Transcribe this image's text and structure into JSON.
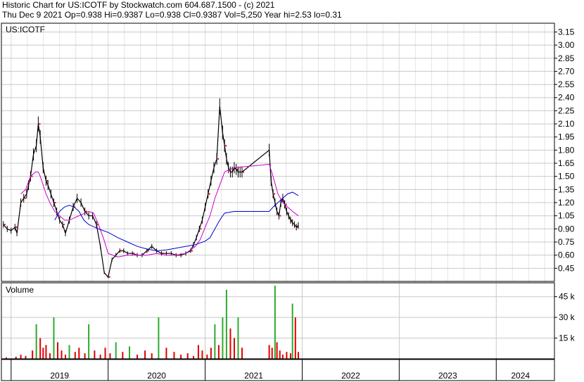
{
  "header": {
    "line1": "Historic Chart for US:ICOTF by Stockwatch.com 604.687.1500 - (c) 2021",
    "line2": "Thu Dec  9 2021   Op=0.938   Hi=0.9387   Lo=0.938   Cl=0.9387   Vol=5,250   Year hi=2.53   lo=0.31"
  },
  "colors": {
    "up": "#2eaa2e",
    "down": "#e00000",
    "price": "#000000",
    "ma_short": "#cc00cc",
    "ma_long": "#0000cc",
    "grid": "#c8c8c8",
    "dot": "#e00000"
  },
  "chart_data": [
    {
      "type": "line",
      "panel": "price",
      "title": "US:ICOTF",
      "xlabel": "",
      "ylabel": "",
      "ylim": [
        0.3,
        3.25
      ],
      "yticks": [
        0.45,
        0.6,
        0.75,
        0.9,
        1.05,
        1.2,
        1.35,
        1.5,
        1.65,
        1.8,
        1.95,
        2.1,
        2.25,
        2.4,
        2.55,
        2.7,
        2.85,
        3.0,
        3.15
      ],
      "ytick_labels": [
        "0.45",
        "0.60",
        "0.75",
        "0.90",
        "1.05",
        "1.20",
        "1.35",
        "1.50",
        "1.65",
        "1.80",
        "1.95",
        "2.10",
        "2.25",
        "2.40",
        "2.55",
        "2.70",
        "2.85",
        "3.00",
        "3.15"
      ],
      "xlim": [
        2018.9,
        2024.6
      ],
      "xtick_labels": [
        "2019",
        "2020",
        "2021",
        "2022",
        "2023",
        "2024"
      ],
      "xtick_positions": [
        2019.5,
        2020.5,
        2021.5,
        2022.5,
        2023.5,
        2024.25
      ],
      "year_boundaries": [
        2019,
        2020,
        2021,
        2022,
        2023,
        2024
      ],
      "grid": true,
      "series": [
        {
          "role": "price",
          "x": [
            2018.92,
            2018.96,
            2019.0,
            2019.04,
            2019.06,
            2019.1,
            2019.13,
            2019.16,
            2019.18,
            2019.2,
            2019.23,
            2019.26,
            2019.28,
            2019.3,
            2019.33,
            2019.36,
            2019.38,
            2019.41,
            2019.44,
            2019.47,
            2019.5,
            2019.53,
            2019.56,
            2019.6,
            2019.64,
            2019.68,
            2019.72,
            2019.76,
            2019.8,
            2019.84,
            2019.88,
            2019.92,
            2019.96,
            2020.0,
            2020.04,
            2020.08,
            2020.12,
            2020.16,
            2020.2,
            2020.25,
            2020.3,
            2020.35,
            2020.4,
            2020.45,
            2020.5,
            2020.55,
            2020.6,
            2020.65,
            2020.7,
            2020.75,
            2020.8,
            2020.85,
            2020.88,
            2020.91,
            2020.94,
            2020.97,
            2021.0,
            2021.03,
            2021.06,
            2021.09,
            2021.12,
            2021.15,
            2021.18,
            2021.2,
            2021.22,
            2021.24,
            2021.26,
            2021.28,
            2021.3,
            2021.32,
            2021.34,
            2021.36,
            2021.38,
            2021.66,
            2021.68,
            2021.7,
            2021.72,
            2021.74,
            2021.76,
            2021.78,
            2021.8,
            2021.82,
            2021.84,
            2021.86,
            2021.88,
            2021.9,
            2021.92,
            2021.94,
            2021.96
          ],
          "y": [
            0.95,
            0.9,
            0.88,
            0.92,
            0.85,
            1.2,
            1.25,
            1.3,
            1.4,
            1.5,
            1.75,
            1.85,
            2.1,
            1.95,
            1.6,
            1.45,
            1.4,
            1.3,
            1.2,
            1.1,
            1.0,
            0.95,
            0.85,
            1.0,
            1.15,
            1.25,
            1.2,
            1.1,
            1.05,
            1.05,
            0.95,
            0.7,
            0.4,
            0.35,
            0.55,
            0.6,
            0.65,
            0.65,
            0.62,
            0.62,
            0.6,
            0.6,
            0.65,
            0.7,
            0.65,
            0.62,
            0.62,
            0.62,
            0.6,
            0.6,
            0.62,
            0.65,
            0.72,
            0.8,
            0.9,
            1.0,
            1.15,
            1.3,
            1.45,
            1.6,
            1.7,
            2.3,
            2.0,
            1.85,
            1.7,
            1.6,
            1.55,
            1.55,
            1.6,
            1.58,
            1.55,
            1.55,
            1.55,
            1.8,
            1.45,
            1.3,
            1.2,
            1.1,
            1.05,
            1.2,
            1.25,
            1.18,
            1.1,
            1.05,
            1.0,
            0.97,
            0.95,
            0.92,
            0.94
          ]
        },
        {
          "role": "moving_average_short",
          "x": [
            2019.1,
            2019.15,
            2019.2,
            2019.25,
            2019.28,
            2019.3,
            2019.33,
            2019.36,
            2019.4,
            2019.45,
            2019.5,
            2019.55,
            2019.6,
            2019.7,
            2019.8,
            2019.85,
            2019.9,
            2019.95,
            2020.0,
            2020.1,
            2020.2,
            2020.3,
            2020.4,
            2020.5,
            2020.6,
            2020.7,
            2020.8,
            2020.9,
            2020.95,
            2021.0,
            2021.05,
            2021.1,
            2021.15,
            2021.2,
            2021.25,
            2021.3,
            2021.4,
            2021.5,
            2021.6,
            2021.66,
            2021.7,
            2021.75,
            2021.8,
            2021.85,
            2021.9,
            2021.96
          ],
          "y": [
            1.3,
            1.35,
            1.5,
            1.55,
            1.55,
            1.5,
            1.4,
            1.3,
            1.2,
            1.1,
            1.05,
            1.0,
            1.0,
            1.05,
            1.1,
            1.08,
            0.95,
            0.8,
            0.62,
            0.58,
            0.6,
            0.6,
            0.6,
            0.62,
            0.6,
            0.6,
            0.62,
            0.7,
            0.78,
            0.92,
            1.05,
            1.25,
            1.4,
            1.55,
            1.58,
            1.6,
            1.61,
            1.62,
            1.63,
            1.64,
            1.5,
            1.3,
            1.2,
            1.15,
            1.1,
            1.05
          ]
        },
        {
          "role": "moving_average_long",
          "x": [
            2019.45,
            2019.5,
            2019.55,
            2019.6,
            2019.65,
            2019.7,
            2019.75,
            2019.8,
            2019.9,
            2020.0,
            2020.1,
            2020.2,
            2020.3,
            2020.4,
            2020.5,
            2020.6,
            2020.7,
            2020.8,
            2020.9,
            2021.0,
            2021.05,
            2021.1,
            2021.15,
            2021.2,
            2021.3,
            2021.4,
            2021.5,
            2021.6,
            2021.66,
            2021.7,
            2021.75,
            2021.8,
            2021.85,
            2021.9,
            2021.96
          ],
          "y": [
            1.0,
            1.1,
            1.15,
            1.17,
            1.15,
            1.1,
            1.0,
            0.95,
            0.9,
            0.86,
            0.8,
            0.75,
            0.7,
            0.67,
            0.65,
            0.66,
            0.68,
            0.7,
            0.72,
            0.76,
            0.8,
            0.9,
            1.0,
            1.08,
            1.1,
            1.1,
            1.1,
            1.1,
            1.1,
            1.15,
            1.2,
            1.25,
            1.3,
            1.32,
            1.28
          ]
        }
      ]
    },
    {
      "type": "bar",
      "panel": "volume",
      "title": "Volume",
      "xlabel": "",
      "ylabel": "",
      "ylim": [
        0,
        52000
      ],
      "yticks": [
        15000,
        30000,
        45000
      ],
      "ytick_labels": [
        "15 k",
        "30 k",
        "45 k"
      ],
      "x": [
        2018.95,
        2019.05,
        2019.1,
        2019.15,
        2019.22,
        2019.26,
        2019.3,
        2019.33,
        2019.36,
        2019.4,
        2019.44,
        2019.48,
        2019.52,
        2019.56,
        2019.6,
        2019.66,
        2019.7,
        2019.76,
        2019.8,
        2019.86,
        2019.92,
        2019.97,
        2020.02,
        2020.08,
        2020.15,
        2020.22,
        2020.3,
        2020.38,
        2020.45,
        2020.52,
        2020.6,
        2020.68,
        2020.75,
        2020.82,
        2020.88,
        2020.93,
        2020.97,
        2021.02,
        2021.06,
        2021.1,
        2021.14,
        2021.18,
        2021.22,
        2021.26,
        2021.3,
        2021.34,
        2021.38,
        2021.66,
        2021.69,
        2021.72,
        2021.74,
        2021.77,
        2021.8,
        2021.84,
        2021.88,
        2021.9,
        2021.93,
        2021.96
      ],
      "values": [
        1000,
        1500,
        3000,
        2000,
        6000,
        25000,
        15000,
        8000,
        10000,
        4000,
        30000,
        12000,
        6000,
        3000,
        10000,
        5000,
        8000,
        4000,
        25000,
        6000,
        3000,
        8000,
        4000,
        12000,
        5000,
        9000,
        3000,
        6000,
        4000,
        30000,
        8000,
        5000,
        3000,
        4000,
        2000,
        10000,
        6000,
        3000,
        8000,
        25000,
        10000,
        30000,
        50000,
        22000,
        15000,
        30000,
        8000,
        10000,
        8000,
        53000,
        12000,
        6000,
        3000,
        5000,
        4000,
        40000,
        30000,
        5000
      ],
      "bar_direction": [
        "down",
        "down",
        "down",
        "down",
        "down",
        "up",
        "down",
        "down",
        "down",
        "down",
        "up",
        "down",
        "down",
        "down",
        "up",
        "down",
        "down",
        "down",
        "up",
        "down",
        "down",
        "down",
        "down",
        "up",
        "down",
        "up",
        "down",
        "down",
        "down",
        "up",
        "down",
        "down",
        "down",
        "down",
        "down",
        "down",
        "down",
        "down",
        "down",
        "up",
        "down",
        "up",
        "up",
        "down",
        "down",
        "up",
        "down",
        "down",
        "down",
        "up",
        "down",
        "down",
        "down",
        "down",
        "down",
        "up",
        "down",
        "down"
      ]
    }
  ]
}
